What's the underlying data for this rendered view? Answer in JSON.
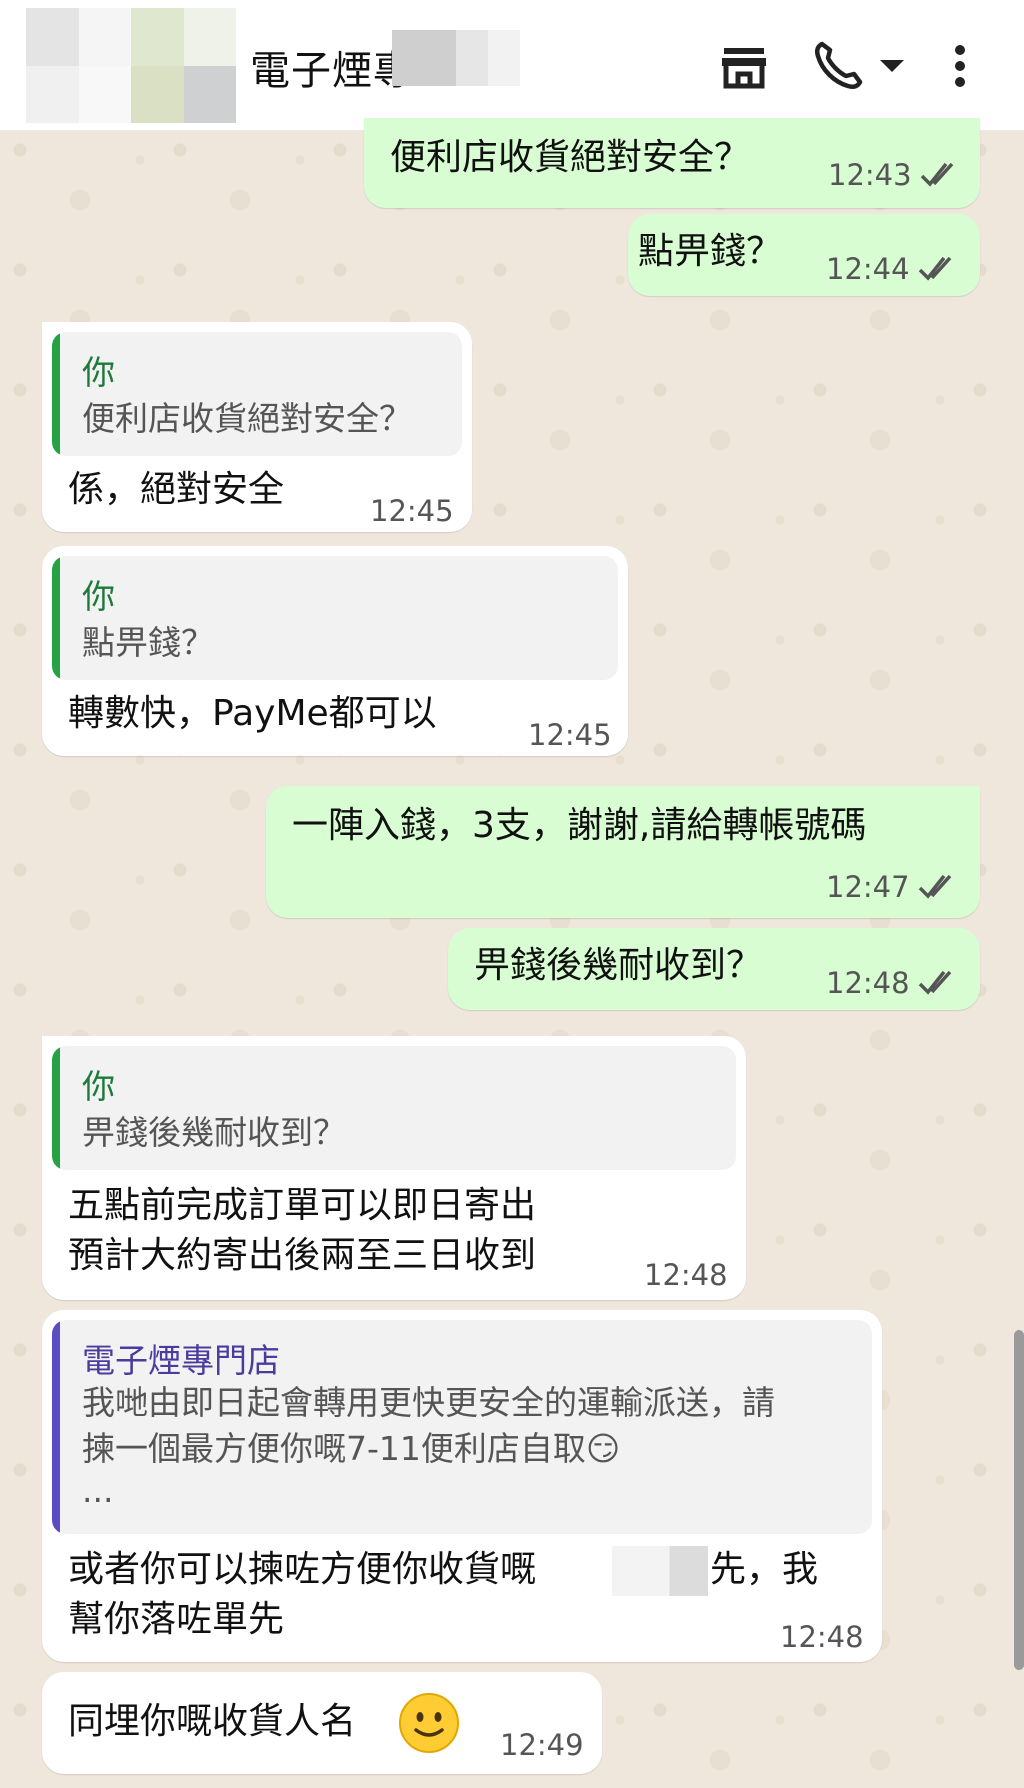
{
  "header": {
    "contact_name": "電子煙專",
    "icons": [
      "store-icon",
      "call-icon",
      "dropdown-icon",
      "more-options-icon"
    ]
  },
  "messages": [
    {
      "id": "m1",
      "direction": "outgoing",
      "text": "便利店收貨絕對安全？",
      "time": "12:43",
      "status": "read"
    },
    {
      "id": "m2",
      "direction": "outgoing",
      "text": "點畀錢？",
      "time": "12:44",
      "status": "read"
    },
    {
      "id": "m3",
      "direction": "incoming",
      "quote_author": "你",
      "quote_text": "便利店收貨絕對安全？",
      "text": "係，絕對安全",
      "time": "12:45"
    },
    {
      "id": "m4",
      "direction": "incoming",
      "quote_author": "你",
      "quote_text": "點畀錢？",
      "text": "轉數快，PayMe都可以",
      "time": "12:45"
    },
    {
      "id": "m5",
      "direction": "outgoing",
      "text": "一陣入錢，3支，謝謝,請給轉帳號碼",
      "time": "12:47",
      "status": "read"
    },
    {
      "id": "m6",
      "direction": "outgoing",
      "text": "畀錢後幾耐收到？",
      "time": "12:48",
      "status": "read"
    },
    {
      "id": "m7",
      "direction": "incoming",
      "quote_author": "你",
      "quote_text": "畀錢後幾耐收到？",
      "text_lines": [
        "五點前完成訂單可以即日寄出",
        "預計大約寄出後兩至三日收到"
      ],
      "time": "12:48"
    },
    {
      "id": "m8",
      "direction": "incoming",
      "quote_author": "電子煙專門店",
      "quote_lines": [
        "我哋由即日起會轉用更快更安全的運輸派送，請",
        "揀一個最方便你嘅7-11便利店自取😏",
        "..."
      ],
      "text_lines": [
        "或者你可以揀咗方便你收貨嘅",
        "先，我",
        "幫你落咗單先"
      ],
      "time": "12:48"
    },
    {
      "id": "m9",
      "direction": "incoming",
      "text": "同埋你嘅收貨人名",
      "emoji": "slightly-smiling-face",
      "time": "12:49"
    }
  ],
  "colors": {
    "outgoing_bubble": "#d8fdd2",
    "incoming_bubble": "#ffffff",
    "quote_bar_self": "#25a244",
    "quote_bar_other": "#5b4bc4",
    "quote_author_self": "#1e7a3c",
    "quote_author_other": "#4b3b9c",
    "read_ticks": "#555555"
  }
}
